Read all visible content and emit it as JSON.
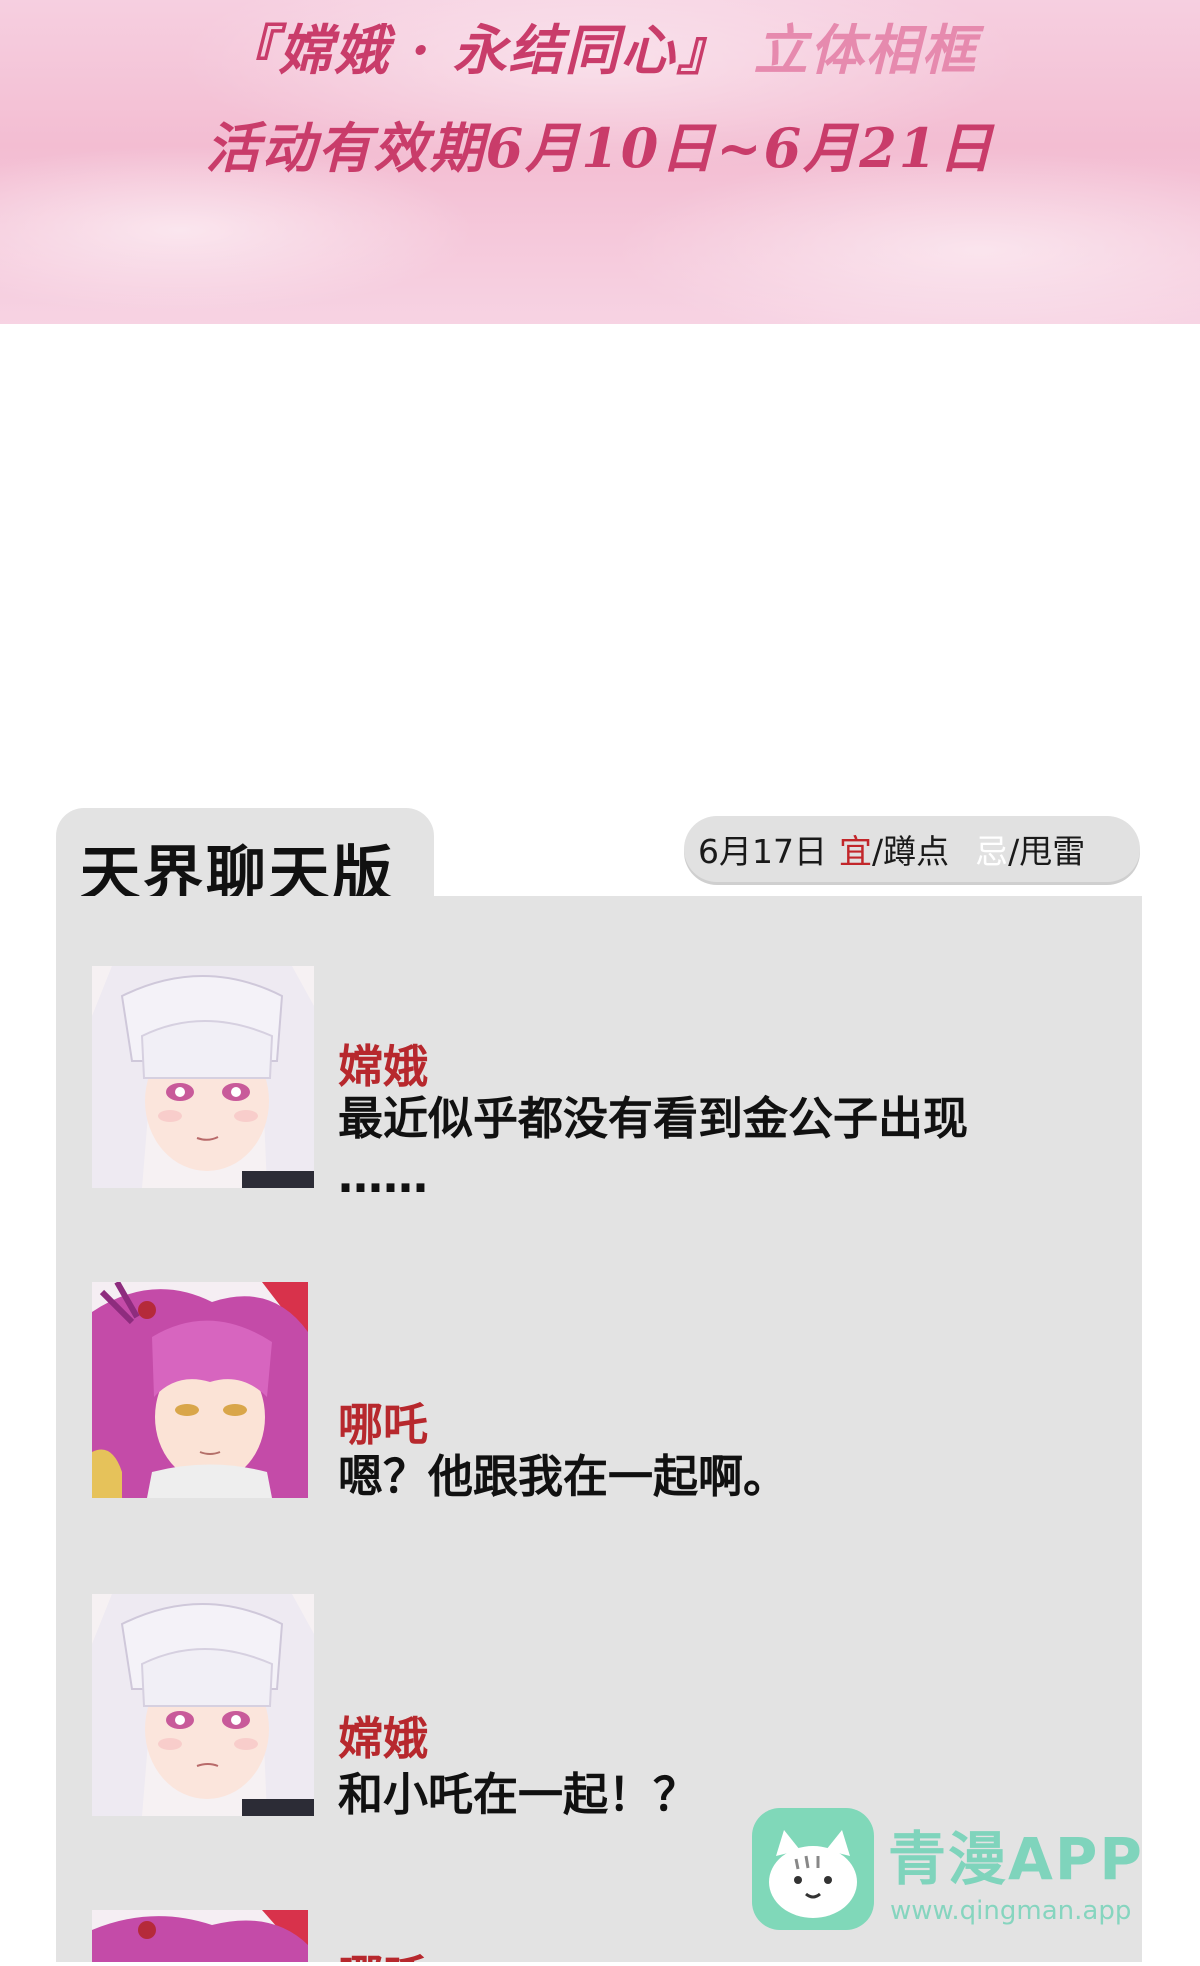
{
  "banner": {
    "title_main": "『嫦娥 · 永结同心』",
    "title_sub": "立体相框",
    "date_text": "活动有效期6月10日~6月21日"
  },
  "chat": {
    "title": "天界聊天版",
    "date": "6月17日",
    "yi_label": "宜",
    "yi_value": "/蹲点",
    "ji_label": "忌",
    "ji_value": "/甩雷",
    "messages": [
      {
        "speaker": "嫦娥",
        "text": "最近似乎都没有看到金公子出现",
        "text_cont": "……"
      },
      {
        "speaker": "哪吒",
        "text": "嗯？他跟我在一起啊。"
      },
      {
        "speaker": "嫦娥",
        "text": "和小吒在一起！？"
      },
      {
        "speaker": "哪吒",
        "text": ""
      }
    ]
  },
  "watermark": {
    "name": "青漫APP",
    "url": "www.qingman.app"
  },
  "colors": {
    "banner_text": "#c93c6a",
    "speaker": "#b7282d",
    "panel_bg": "#e3e3e3",
    "watermark": "#5ecfaf"
  }
}
